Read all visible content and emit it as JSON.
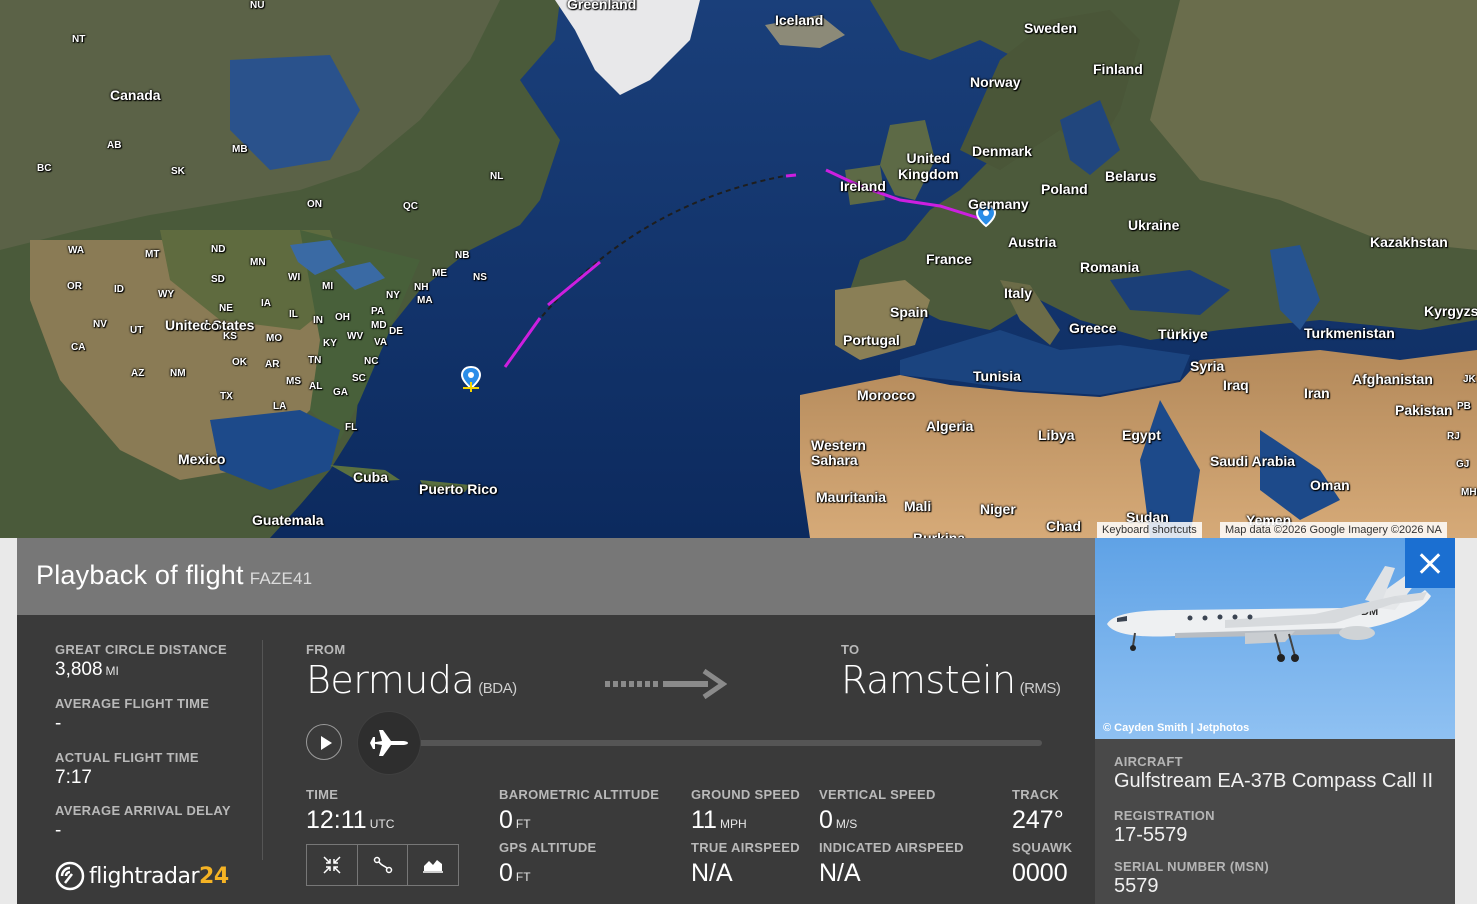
{
  "map": {
    "labels": {
      "nu": "NU",
      "nt": "NT",
      "canada": "Canada",
      "ab": "AB",
      "mb": "MB",
      "bc": "BC",
      "sk": "SK",
      "on": "ON",
      "qc": "QC",
      "nl": "NL",
      "greenland": "Greenland",
      "iceland": "Iceland",
      "sweden": "Sweden",
      "finland": "Finland",
      "norway": "Norway",
      "united_kingdom": "United\nKingdom",
      "denmark": "Denmark",
      "ireland": "Ireland",
      "poland": "Poland",
      "belarus": "Belarus",
      "germany": "Germany",
      "ukraine": "Ukraine",
      "kazakhstan": "Kazakhstan",
      "austria": "Austria",
      "france": "France",
      "romania": "Romania",
      "italy": "Italy",
      "spain": "Spain",
      "portugal": "Portugal",
      "greece": "Greece",
      "turkiye": "Türkiye",
      "turkmenistan": "Turkmenistan",
      "kyrgyz": "Kyrgyzs",
      "morocco": "Morocco",
      "tunisia": "Tunisia",
      "syria": "Syria",
      "iraq": "Iraq",
      "afghanistan": "Afghanistan",
      "iran": "Iran",
      "pakistan": "Pakistan",
      "jk": "JK",
      "pb": "PB",
      "rj": "RJ",
      "gj": "GJ",
      "mh": "MH",
      "algeria": "Algeria",
      "libya": "Libya",
      "egypt": "Egypt",
      "saudi_arabia": "Saudi Arabia",
      "oman": "Oman",
      "western_sahara": "Western\nSahara",
      "mauritania": "Mauritania",
      "mali": "Mali",
      "niger": "Niger",
      "chad": "Chad",
      "sudan": "Sudan",
      "yemen": "Yemen",
      "burkina": "Burkina",
      "wa": "WA",
      "mt": "MT",
      "nd": "ND",
      "mn": "MN",
      "or": "OR",
      "id": "ID",
      "wy": "WY",
      "sd": "SD",
      "wi": "WI",
      "mi": "MI",
      "ny": "NY",
      "nb": "NB",
      "ns": "NS",
      "me": "ME",
      "nh": "NH",
      "ma": "MA",
      "ne": "NE",
      "ia": "IA",
      "nv": "NV",
      "ut": "UT",
      "united_states": "United States",
      "il": "IL",
      "in": "IN",
      "oh": "OH",
      "pa": "PA",
      "md": "MD",
      "de": "DE",
      "ca": "CA",
      "co": "CO",
      "ks": "KS",
      "mo": "MO",
      "ky": "KY",
      "wv": "WV",
      "va": "VA",
      "az": "AZ",
      "nm": "NM",
      "ok": "OK",
      "ar": "AR",
      "tn": "TN",
      "nc": "NC",
      "tx": "TX",
      "ms": "MS",
      "al": "AL",
      "ga": "GA",
      "sc": "SC",
      "la": "LA",
      "fl": "FL",
      "mexico": "Mexico",
      "cuba": "Cuba",
      "puerto_rico": "Puerto Rico",
      "guatemala": "Guatemala"
    },
    "keyboard_shortcuts": "Keyboard shortcuts",
    "map_data": "Map data ©2026 Google Imagery ©2026 NA"
  },
  "panel": {
    "title": "Playback of flight",
    "callsign": "FAZE41",
    "stats": {
      "great_circle_label": "GREAT CIRCLE DISTANCE",
      "great_circle_value": "3,808",
      "great_circle_unit": "MI",
      "avg_flight_label": "AVERAGE FLIGHT TIME",
      "avg_flight_value": "-",
      "actual_flight_label": "ACTUAL FLIGHT TIME",
      "actual_flight_value": "7:17",
      "avg_arrival_label": "AVERAGE ARRIVAL DELAY",
      "avg_arrival_value": "-"
    },
    "route": {
      "from_label": "FROM",
      "from_city": "Bermuda",
      "from_code": "(BDA)",
      "to_label": "TO",
      "to_city": "Ramstein",
      "to_code": "(RMS)"
    },
    "playback": {
      "progress": 0.0
    },
    "telemetry": {
      "time_label": "TIME",
      "time_value": "12:11",
      "time_unit": "UTC",
      "baro_label": "BAROMETRIC ALTITUDE",
      "baro_value": "0",
      "baro_unit": "FT",
      "gps_label": "GPS ALTITUDE",
      "gps_value": "0",
      "gps_unit": "FT",
      "gs_label": "GROUND SPEED",
      "gs_value": "11",
      "gs_unit": "MPH",
      "tas_label": "TRUE AIRSPEED",
      "tas_value": "N/A",
      "vs_label": "VERTICAL SPEED",
      "vs_value": "0",
      "vs_unit": "M/S",
      "ias_label": "INDICATED AIRSPEED",
      "ias_value": "N/A",
      "track_label": "TRACK",
      "track_value": "247°",
      "squawk_label": "SQUAWK",
      "squawk_value": "0000"
    },
    "logo": {
      "text": "flightradar",
      "num": "24"
    },
    "tools": [
      "compress-icon",
      "route-icon",
      "chart-icon"
    ]
  },
  "aircraft": {
    "photo_credit": "© Cayden Smith | Jetphotos",
    "aircraft_label": "AIRCRAFT",
    "aircraft_value": "Gulfstream EA-37B Compass Call II",
    "registration_label": "REGISTRATION",
    "registration_value": "17-5579",
    "serial_label": "SERIAL NUMBER (MSN)",
    "serial_value": "5579",
    "tail_code": "DM"
  },
  "colors": {
    "route_flown": "#cc1fe0",
    "route_planned": "#222222",
    "close_button": "#1b6fd1",
    "logo_accent": "#f5b324"
  }
}
